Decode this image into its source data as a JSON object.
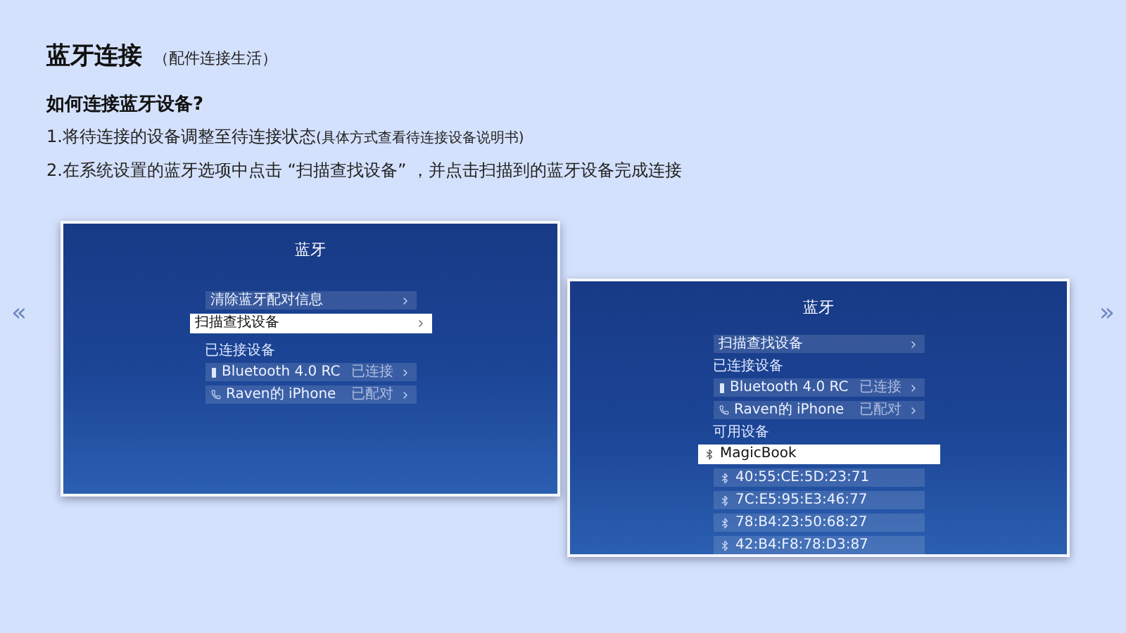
{
  "header": {
    "title": "蓝牙连接",
    "subtitle": "（配件连接生活）"
  },
  "question": "如何连接蓝牙设备?",
  "steps": [
    {
      "text": "1.将待连接的设备调整至待连接状态",
      "note": "(具体方式查看待连接设备说明书)"
    },
    {
      "text": "2.在系统设置的蓝牙选项中点击 “扫描查找设备” ，并点击扫描到的蓝牙设备完成连接"
    }
  ],
  "nav": {
    "prev": "«",
    "next": "»"
  },
  "screens": [
    {
      "title": "蓝牙",
      "sections": [
        {
          "items": [
            {
              "kind": "action",
              "text": "清除蓝牙配对信息",
              "selected": false
            },
            {
              "kind": "action",
              "text": "扫描查找设备",
              "selected": true
            }
          ]
        },
        {
          "label": "已连接设备",
          "items": [
            {
              "kind": "remote",
              "text": "Bluetooth 4.0 RC",
              "status": "已连接",
              "selected": false
            },
            {
              "kind": "phone",
              "text": "Raven的 iPhone",
              "status": "已配对",
              "selected": false
            }
          ]
        }
      ]
    },
    {
      "title": "蓝牙",
      "sections": [
        {
          "items": [
            {
              "kind": "action",
              "text": "扫描查找设备",
              "selected": false
            }
          ]
        },
        {
          "label": "已连接设备",
          "items": [
            {
              "kind": "remote",
              "text": "Bluetooth 4.0 RC",
              "status": "已连接",
              "selected": false
            },
            {
              "kind": "phone",
              "text": "Raven的 iPhone",
              "status": "已配对",
              "selected": false
            }
          ]
        },
        {
          "label": "可用设备",
          "items": [
            {
              "kind": "device",
              "text": "MagicBook",
              "selected": true
            },
            {
              "kind": "device",
              "text": "40:55:CE:5D:23:71",
              "selected": false
            },
            {
              "kind": "device",
              "text": "7C:E5:95:E3:46:77",
              "selected": false
            },
            {
              "kind": "device",
              "text": "78:B4:23:50:68:27",
              "selected": false
            },
            {
              "kind": "device",
              "text": "42:B4:F8:78:D3:87",
              "selected": false
            }
          ]
        }
      ]
    }
  ]
}
